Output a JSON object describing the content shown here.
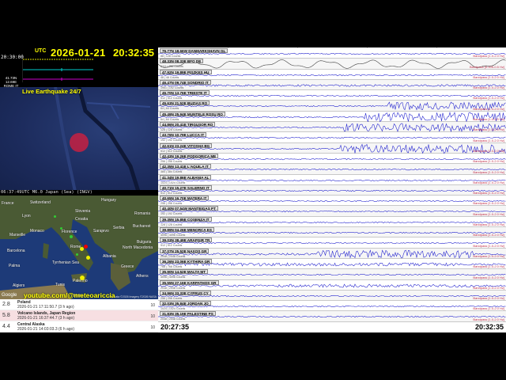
{
  "header": {
    "utc_label": "UTC",
    "date": "2026-01-21",
    "time": "20:32:35",
    "mini_time": "20:30:00",
    "station": [
      "41.73N",
      "12.69E",
      "ROME IT"
    ]
  },
  "map1": {
    "title": "Live Earthquake 24/7",
    "caption": "06:37:49UTC M6.0 Japan (Sea) (INGV)"
  },
  "map2": {
    "labels": [
      "France",
      "Switzerland",
      "Hungary",
      "Slovenia",
      "Croatia",
      "Romania",
      "Serbia",
      "Bulgaria",
      "Monaco",
      "Marseille",
      "Barcelona",
      "Palma",
      "Algiers",
      "Tunis",
      "Malta",
      "Greece",
      "Albania",
      "Rome",
      "Florence",
      "Palermo",
      "Lyon",
      "Bucharest",
      "Sarajevo",
      "North Macedonia",
      "Tyrrhenian Sea",
      "Athens"
    ],
    "watermark": "youtube.com/@meteoariccia",
    "google": "Google",
    "attribution": "Map data ©2026 Imagery ©2026 NASA"
  },
  "quakes": [
    {
      "mag": "2.8",
      "place": "Poland",
      "time": "2026-01-21 17:11:50.7 (3 h ago)",
      "depth": "10"
    },
    {
      "mag": "5.8",
      "place": "Volcano Islands, Japan Region",
      "time": "2026-01-21 16:37:44.7 (3 h ago)",
      "depth": "10"
    },
    {
      "mag": "4.4",
      "place": "Central Alaska",
      "time": "2026-01-21 14:03:03.3 (6 h ago)",
      "depth": "10"
    }
  ],
  "seismo": {
    "start_time": "20:27:35",
    "end_time": "20:32:35",
    "stations": [
      {
        "name": "76.77N 18.66W DANMARKSHAVN GL",
        "counts": "88 | 128 Counts",
        "filter": "Bandpass [1.0-2.0 Hz]"
      },
      {
        "name": "48.33N 08.33E BFO DE",
        "counts": "2111 | 256 Counts",
        "filter": "Bandpass [0.005-0.5 Hz]"
      },
      {
        "name": "47.92N 19.89E PISZKES HU",
        "counts": "48 | 48 Counts",
        "filter": "Bandpass [1.0-2.0 Hz]"
      },
      {
        "name": "46.47N 09.74E SONDRIO IT",
        "counts": "1951 | 192 Counts",
        "filter": "Bandpass [1.0-2.0 Hz]"
      },
      {
        "name": "45.70N 13.76E TRIESTE IT",
        "counts": "512 | 512 Counts",
        "filter": "Bandpass [1.0-2.0 Hz]"
      },
      {
        "name": "45.63N 21.52E BUZIAS RO",
        "counts": "64 | 64 Counts",
        "filter": "Bandpass [1.0-2.0 Hz]"
      },
      {
        "name": "45.49N 25.94E MUNTELE ROSU RO",
        "counts": "64 | 64 Counts",
        "filter": "Bandpass [1.0-2.0 Hz]"
      },
      {
        "name": "44.86N 20.41E TIRGUSOR RO",
        "counts": "128 | 128 Counts",
        "filter": "Bandpass [1.0-2.0 Hz]"
      },
      {
        "name": "43.76N 10.79E LUCCA IT",
        "counts": "192 | 192 Counts",
        "filter": "Bandpass [1.0-2.0 Hz]"
      },
      {
        "name": "42.61N 23.24E VITOSHA BG",
        "counts": "512 | 512 Counts",
        "filter": "Bandpass [1.0-2.0 Hz]"
      },
      {
        "name": "42.43N 19.26E PODGORICA ME",
        "counts": "256 | 256 Counts",
        "filter": "Bandpass [1.0-2.0 Hz]"
      },
      {
        "name": "42.35N 13.41E L'AQUILA IT",
        "counts": "384 | 384 Counts",
        "filter": "Bandpass [1.0-2.0 Hz]"
      },
      {
        "name": "41.34N 19.86E ALBANIA AL",
        "counts": "1024 | 1024 Counts",
        "filter": "Bandpass [1.0-2.0 Hz]"
      },
      {
        "name": "40.71N 15.27E SALERNO IT",
        "counts": "512 | 512 Counts",
        "filter": "Bandpass [1.0-2.0 Hz]"
      },
      {
        "name": "40.65N 16.70E MATERA IT",
        "counts": "256 | 256 Counts",
        "filter": "Bandpass [1.0-2.0 Hz]"
      },
      {
        "name": "40.40N 07.54W MANTEIGAS PT",
        "counts": "192 | 192 Counts",
        "filter": "Bandpass [1.0-2.0 Hz]"
      },
      {
        "name": "39.35N 15.85E COSENZA IT",
        "counts": "128 | 128 Counts",
        "filter": "Bandpass [1.0-2.0 Hz]"
      },
      {
        "name": "39.89N 04.26E MENORCA ES",
        "counts": "4096 | 4096 Counts",
        "filter": "Bandpass [1.0-2.0 Hz]"
      },
      {
        "name": "39.03N 38.49E ARAPGIR TR",
        "counts": "512 | 512 Counts",
        "filter": "Bandpass [1.0-2.0 Hz]"
      },
      {
        "name": "37.07N 25.52E NAXOS GR",
        "counts": "2048 | 2048 Counts",
        "filter": "Bandpass [1.0-2.0 Hz]"
      },
      {
        "name": "36.26N 23.06E KYTHIRA GR",
        "counts": "768 | 768 Counts",
        "filter": "Bandpass [1.0-2.0 Hz]"
      },
      {
        "name": "35.90N 14.52E MALTA MT",
        "counts": "4096 | 4096 Counts",
        "filter": "Bandpass [1.0-2.0 Hz]"
      },
      {
        "name": "35.55N 27.16E KARPATHOS GR",
        "counts": "2048 | 2048 Counts",
        "filter": "Bandpass [1.0-2.0 Hz]"
      },
      {
        "name": "34.96N 33.33E CYPRUS CY",
        "counts": "256 | 256 Counts",
        "filter": "Bandpass [1.0-2.0 Hz]"
      },
      {
        "name": "32.03N 35.84E JORDAN JO",
        "counts": "1024 | 1024 Counts",
        "filter": "Bandpass [1.0-2.0 Hz]"
      },
      {
        "name": "31.83N 35.19E PALESTINE PS",
        "counts": "2048 | 2048 Counts",
        "filter": "Bandpass [1.0-2.0 Hz]"
      }
    ]
  }
}
